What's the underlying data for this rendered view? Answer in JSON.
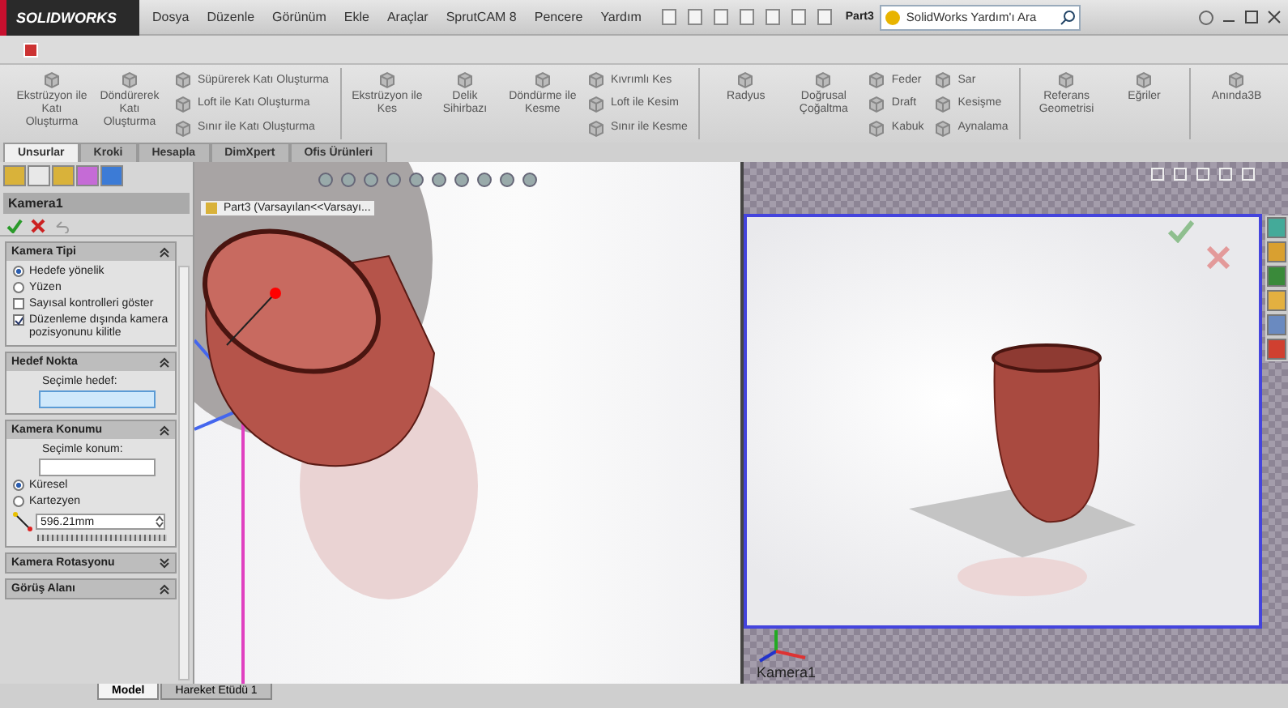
{
  "app": {
    "logo": "SOLIDWORKS"
  },
  "menu": [
    "Dosya",
    "Düzenle",
    "Görünüm",
    "Ekle",
    "Araçlar",
    "SprutCAM 8",
    "Pencere",
    "Yardım"
  ],
  "document": "Part3",
  "help_search": {
    "placeholder": "SolidWorks Yardım'ı Ara"
  },
  "ribbon": {
    "groups": [
      {
        "large": [
          "Ekstrüzyon ile Katı Oluşturma",
          "Döndürerek Katı Oluşturma"
        ],
        "small": [
          "Süpürerek Katı Oluşturma",
          "Loft ile Katı Oluşturma",
          "Sınır ile Katı Oluşturma"
        ]
      },
      {
        "large": [
          "Ekstrüzyon ile Kes",
          "Delik Sihirbazı",
          "Döndürme ile Kesme"
        ],
        "small": [
          "Kıvrımlı Kes",
          "Loft ile Kesim",
          "Sınır ile Kesme"
        ]
      },
      {
        "large": [
          "Radyus",
          "Doğrusal Çoğaltma"
        ],
        "small": [
          "Feder",
          "Draft",
          "Kabuk",
          "Sar",
          "Kesişme",
          "Aynalama"
        ]
      },
      {
        "large": [
          "Referans Geometrisi",
          "Eğriler"
        ]
      },
      {
        "large": [
          "Anında3B"
        ]
      }
    ]
  },
  "tabs": [
    {
      "label": "Unsurlar",
      "selected": true
    },
    {
      "label": "Kroki",
      "selected": false
    },
    {
      "label": "Hesapla",
      "selected": false
    },
    {
      "label": "DimXpert",
      "selected": false
    },
    {
      "label": "Ofis Ürünleri",
      "selected": false
    }
  ],
  "panel": {
    "title": "Kamera1",
    "sections": [
      {
        "title": "Kamera Tipi",
        "expanded": true,
        "items": [
          {
            "kind": "radio",
            "label": "Hedefe yönelik",
            "selected": true
          },
          {
            "kind": "radio",
            "label": "Yüzen",
            "selected": false
          },
          {
            "kind": "checkbox",
            "label": "Sayısal kontrolleri göster",
            "checked": false
          },
          {
            "kind": "checkbox",
            "label": "Düzenleme dışında kamera pozisyonunu kilitle",
            "checked": true
          }
        ]
      },
      {
        "title": "Hedef Nokta",
        "expanded": true,
        "items": [
          {
            "kind": "label",
            "label": "Seçimle hedef:"
          },
          {
            "kind": "field",
            "active": true
          }
        ]
      },
      {
        "title": "Kamera Konumu",
        "expanded": true,
        "items": [
          {
            "kind": "label",
            "label": "Seçimle konum:"
          },
          {
            "kind": "field",
            "active": false
          },
          {
            "kind": "radio",
            "label": "Küresel",
            "selected": true
          },
          {
            "kind": "radio",
            "label": "Kartezyen",
            "selected": false
          },
          {
            "kind": "spin",
            "value": "596.21mm"
          }
        ]
      },
      {
        "title": "Kamera Rotasyonu",
        "expanded": false
      },
      {
        "title": "Görüş Alanı",
        "expanded": true
      }
    ]
  },
  "tree": {
    "label": "Part3  (Varsayılan<<Varsayı..."
  },
  "camera_view": {
    "label": "Kamera1"
  },
  "bottom_tabs": [
    {
      "label": "Model",
      "selected": true
    },
    {
      "label": "Hareket Etüdü 1",
      "selected": false
    }
  ]
}
